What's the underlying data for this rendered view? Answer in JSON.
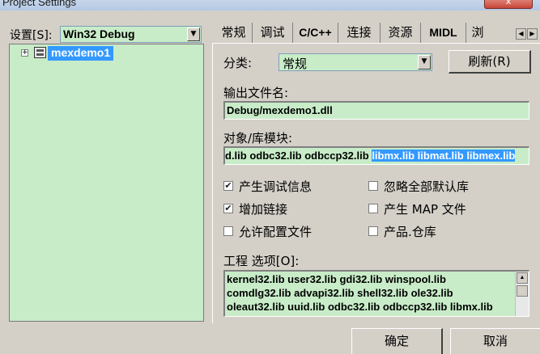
{
  "window": {
    "title": "Project Settings",
    "close_label": "x"
  },
  "left": {
    "settings_label": "设置[S]:",
    "config_value": "Win32 Debug",
    "tree_expander": "+",
    "tree_node": "mexdemo1"
  },
  "tabs": [
    "常规",
    "调试",
    "C/C++",
    "连接",
    "资源",
    "MIDL",
    "浏"
  ],
  "active_tab": "连接",
  "link": {
    "category_label": "分类:",
    "category_value": "常规",
    "reset_button": "刷新(R)",
    "output_label": "输出文件名:",
    "output_value": "Debug/mexdemo1.dll",
    "modules_label": "对象/库模块:",
    "modules_value_plain": "d.lib odbc32.lib odbccp32.lib ",
    "modules_value_selected": "libmx.lib libmat.lib libmex.lib",
    "checks": [
      {
        "label": "产生调试信息",
        "checked": true
      },
      {
        "label": "忽略全部默认库",
        "checked": false
      },
      {
        "label": "增加链接",
        "checked": true
      },
      {
        "label": "产生 MAP 文件",
        "checked": false
      },
      {
        "label": "允许配置文件",
        "checked": false
      },
      {
        "label": "产品.仓库",
        "checked": false
      }
    ],
    "options_label": "工程 选项[O]:",
    "options_lines": [
      "kernel32.lib user32.lib gdi32.lib winspool.lib",
      "comdlg32.lib advapi32.lib shell32.lib ole32.lib",
      "oleaut32.lib uuid.lib odbc32.lib odbccp32.lib libmx.lib"
    ]
  },
  "buttons": {
    "ok": "确定",
    "cancel": "取消"
  }
}
